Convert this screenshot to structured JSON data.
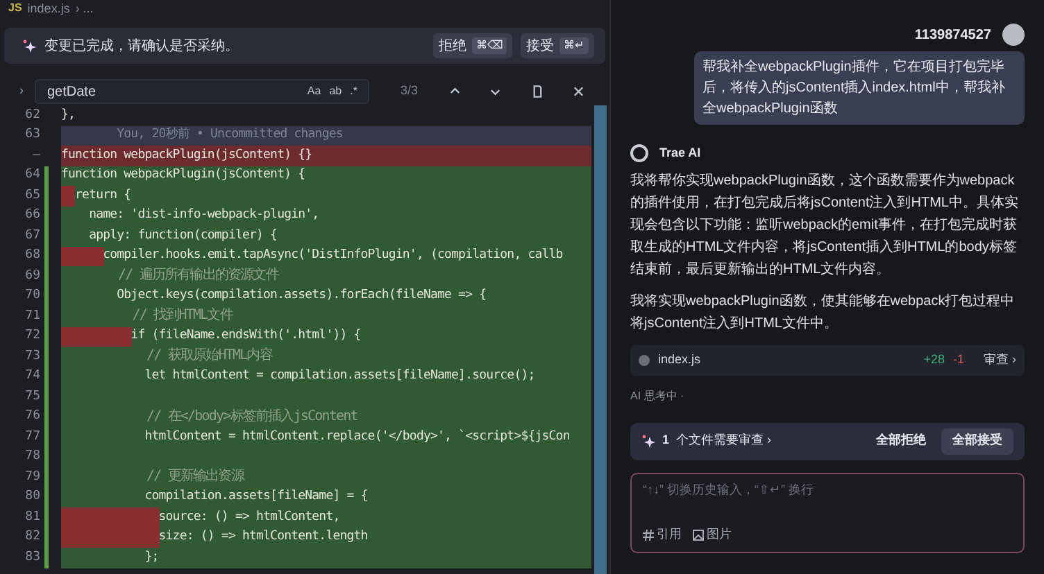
{
  "tab": {
    "icon_text": "JS",
    "label": "index.js",
    "breadcrumb": "› ..."
  },
  "banner": {
    "message": "变更已完成，请确认是否采纳。",
    "buttons": [
      {
        "label": "拒绝",
        "shortcut": "⌘⌫"
      },
      {
        "label": "接受",
        "shortcut": "⌘↵"
      }
    ]
  },
  "find": {
    "toggle": "›",
    "value": "getDate",
    "options": [
      "Aa",
      "ab",
      ".*"
    ],
    "count": "3/3"
  },
  "code_lines": [
    {
      "number": "62",
      "kind": "plain",
      "marker": false,
      "text": "},"
    },
    {
      "number": "63",
      "kind": "blame",
      "marker": false,
      "text": "        You, 20秒前 • Uncommitted changes"
    },
    {
      "number": "—",
      "kind": "removed",
      "marker": false,
      "text": "function webpackPlugin(jsContent) {}"
    },
    {
      "number": "64",
      "kind": "added",
      "marker": false,
      "text": "function webpackPlugin(jsContent) {"
    },
    {
      "number": "65",
      "kind": "added",
      "marker": true,
      "text": "  return {"
    },
    {
      "number": "66",
      "kind": "added",
      "marker": false,
      "text": "    name: 'dist-info-webpack-plugin',"
    },
    {
      "number": "67",
      "kind": "added",
      "marker": false,
      "text": "    apply: function(compiler) {"
    },
    {
      "number": "68",
      "kind": "added",
      "marker": true,
      "text": "      compiler.hooks.emit.tapAsync('DistInfoPlugin', (compilation, callb"
    },
    {
      "number": "69",
      "kind": "comment",
      "marker": false,
      "text": "        // 遍历所有输出的资源文件"
    },
    {
      "number": "70",
      "kind": "added",
      "marker": false,
      "text": "        Object.keys(compilation.assets).forEach(fileName => {"
    },
    {
      "number": "71",
      "kind": "comment",
      "marker": false,
      "text": "          // 找到HTML文件"
    },
    {
      "number": "72",
      "kind": "added",
      "marker": true,
      "text": "          if (fileName.endsWith('.html')) {"
    },
    {
      "number": "73",
      "kind": "comment",
      "marker": false,
      "text": "            // 获取原始HTML内容"
    },
    {
      "number": "74",
      "kind": "added",
      "marker": false,
      "text": "            let htmlContent = compilation.assets[fileName].source();"
    },
    {
      "number": "75",
      "kind": "added",
      "marker": false
    },
    {
      "number": "76",
      "kind": "comment",
      "marker": false,
      "text": "            // 在</body>标签前插入jsContent"
    },
    {
      "number": "77",
      "kind": "added",
      "marker": false,
      "text": "            htmlContent = htmlContent.replace('</body>', `<script>${jsCon"
    },
    {
      "number": "78",
      "kind": "added",
      "marker": false
    },
    {
      "number": "79",
      "kind": "comment",
      "marker": false,
      "text": "            // 更新输出资源"
    },
    {
      "number": "80",
      "kind": "added",
      "marker": false,
      "text": "            compilation.assets[fileName] = {"
    },
    {
      "number": "81",
      "kind": "added",
      "marker": true,
      "text": "              source: () => htmlContent,"
    },
    {
      "number": "82",
      "kind": "added",
      "marker": true,
      "text": "              size: () => htmlContent.length"
    },
    {
      "number": "83",
      "kind": "added",
      "marker": false,
      "text": "            };"
    }
  ],
  "user": {
    "name": "1139874527"
  },
  "user_message": "帮我补全webpackPlugin插件，它在项目打包完毕后，将传入的jsContent插入index.html中，帮我补全webpackPlugin函数",
  "assistant": {
    "name": "Trae AI",
    "paragraphs": [
      "我将帮你实现webpackPlugin函数，这个函数需要作为webpack的插件使用，在打包完成后将jsContent注入到HTML中。具体实现会包含以下功能：监听webpack的emit事件，在打包完成时获取生成的HTML文件内容，将jsContent插入到HTML的body标签结束前，最后更新输出的HTML文件内容。",
      "我将实现webpackPlugin函数，使其能够在webpack打包过程中将jsContent注入到HTML文件中。"
    ],
    "file": {
      "name": "index.js",
      "added": "+28",
      "removed": "-1",
      "action": "审查 ›"
    }
  },
  "status": "AI 思考中 ·",
  "review_bar": {
    "count": "1",
    "label": "个文件需要审查 ›",
    "buttons": [
      {
        "label": "全部拒绝",
        "kind": "plain"
      },
      {
        "label": "全部接受",
        "kind": "filled"
      }
    ]
  },
  "input": {
    "placeholder": "“↑↓” 切换历史输入，“⇧↵” 换行",
    "tools": [
      {
        "kind": "hash",
        "label": "引用"
      },
      {
        "kind": "image",
        "label": "图片"
      }
    ]
  }
}
